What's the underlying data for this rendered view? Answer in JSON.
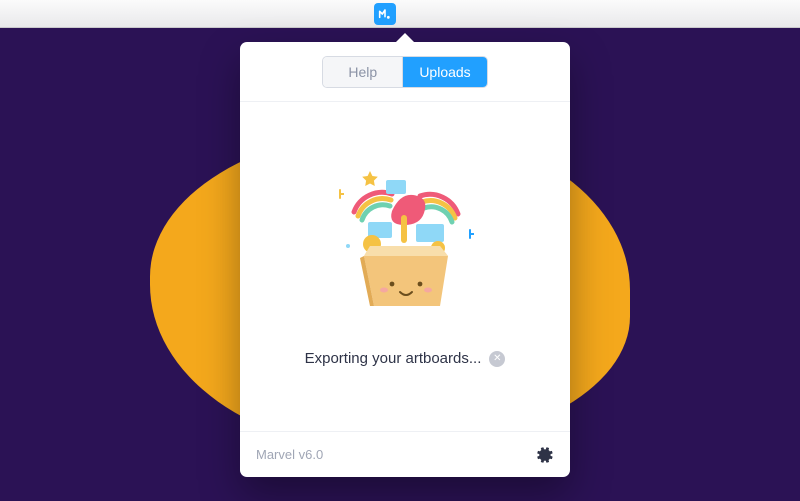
{
  "app": {
    "icon_name": "marvel-logo"
  },
  "tabs": {
    "help_label": "Help",
    "uploads_label": "Uploads",
    "active": "uploads"
  },
  "status": {
    "message": "Exporting your artboards...",
    "cancel_glyph": "✕"
  },
  "footer": {
    "version_label": "Marvel v6.0"
  },
  "colors": {
    "accent": "#21a0ff",
    "background": "#2b1255",
    "blob": "#f4a81c"
  }
}
